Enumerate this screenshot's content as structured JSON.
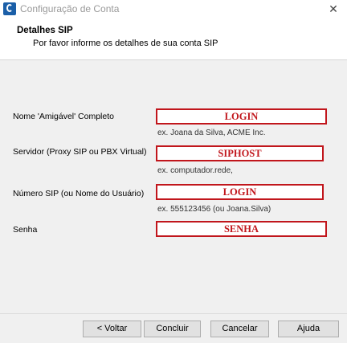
{
  "window": {
    "title": "Configuração de Conta",
    "close_glyph": "✕",
    "icon": "app-logo-icon"
  },
  "header": {
    "title": "Detalhes SIP",
    "subtitle": "Por favor informe os detalhes de sua conta SIP"
  },
  "form": {
    "friendly_name": {
      "label": "Nome 'Amigável' Completo",
      "value": "LOGIN",
      "hint": "ex. Joana da Silva, ACME Inc."
    },
    "server": {
      "label": "Servidor (Proxy SIP ou PBX Virtual)",
      "value": "SIPHOST",
      "hint": "ex. computador.rede,"
    },
    "sip_number": {
      "label": "Número SIP (ou Nome do Usuário)",
      "value": "LOGIN",
      "hint": "ex. 555123456 (ou Joana.Silva)"
    },
    "password": {
      "label": "Senha",
      "value": "SENHA"
    }
  },
  "buttons": {
    "back": "< Voltar",
    "next": "Concluir",
    "cancel": "Cancelar",
    "help": "Ajuda"
  },
  "colors": {
    "field_border": "#c1161c",
    "field_text": "#c1161c"
  }
}
